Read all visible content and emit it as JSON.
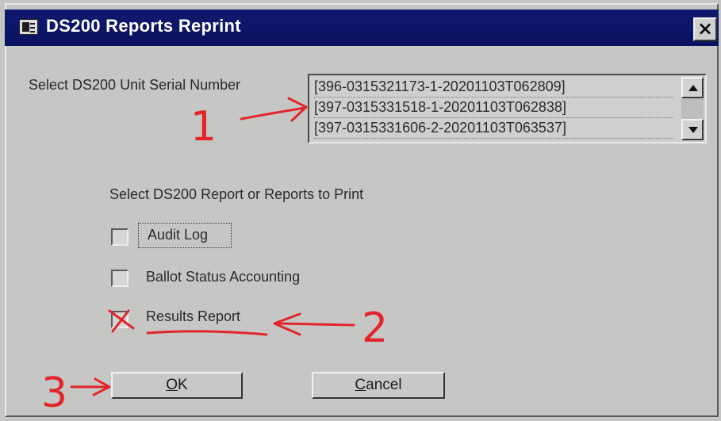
{
  "window": {
    "title": "DS200 Reports Reprint",
    "close_glyph": "×"
  },
  "serial": {
    "label": "Select DS200 Unit Serial Number",
    "items": [
      "[396-0315321173-1-20201103T062809]",
      "[397-0315331518-1-20201103T062838]",
      "[397-0315331606-2-20201103T063537]"
    ]
  },
  "reports": {
    "label": "Select DS200 Report or Reports to Print",
    "options": [
      {
        "label": "Audit Log",
        "checked": false
      },
      {
        "label": "Ballot Status Accounting",
        "checked": false
      },
      {
        "label": "Results Report",
        "checked": true
      }
    ]
  },
  "buttons": {
    "ok_accel": "O",
    "ok_rest": "K",
    "cancel_accel": "C",
    "cancel_rest": "ancel"
  },
  "annotations": {
    "color": "#e2252a",
    "marks": [
      "1",
      "2",
      "3"
    ]
  },
  "colors": {
    "titlebar": "#0a1260",
    "dialog": "#c6c7c5"
  }
}
